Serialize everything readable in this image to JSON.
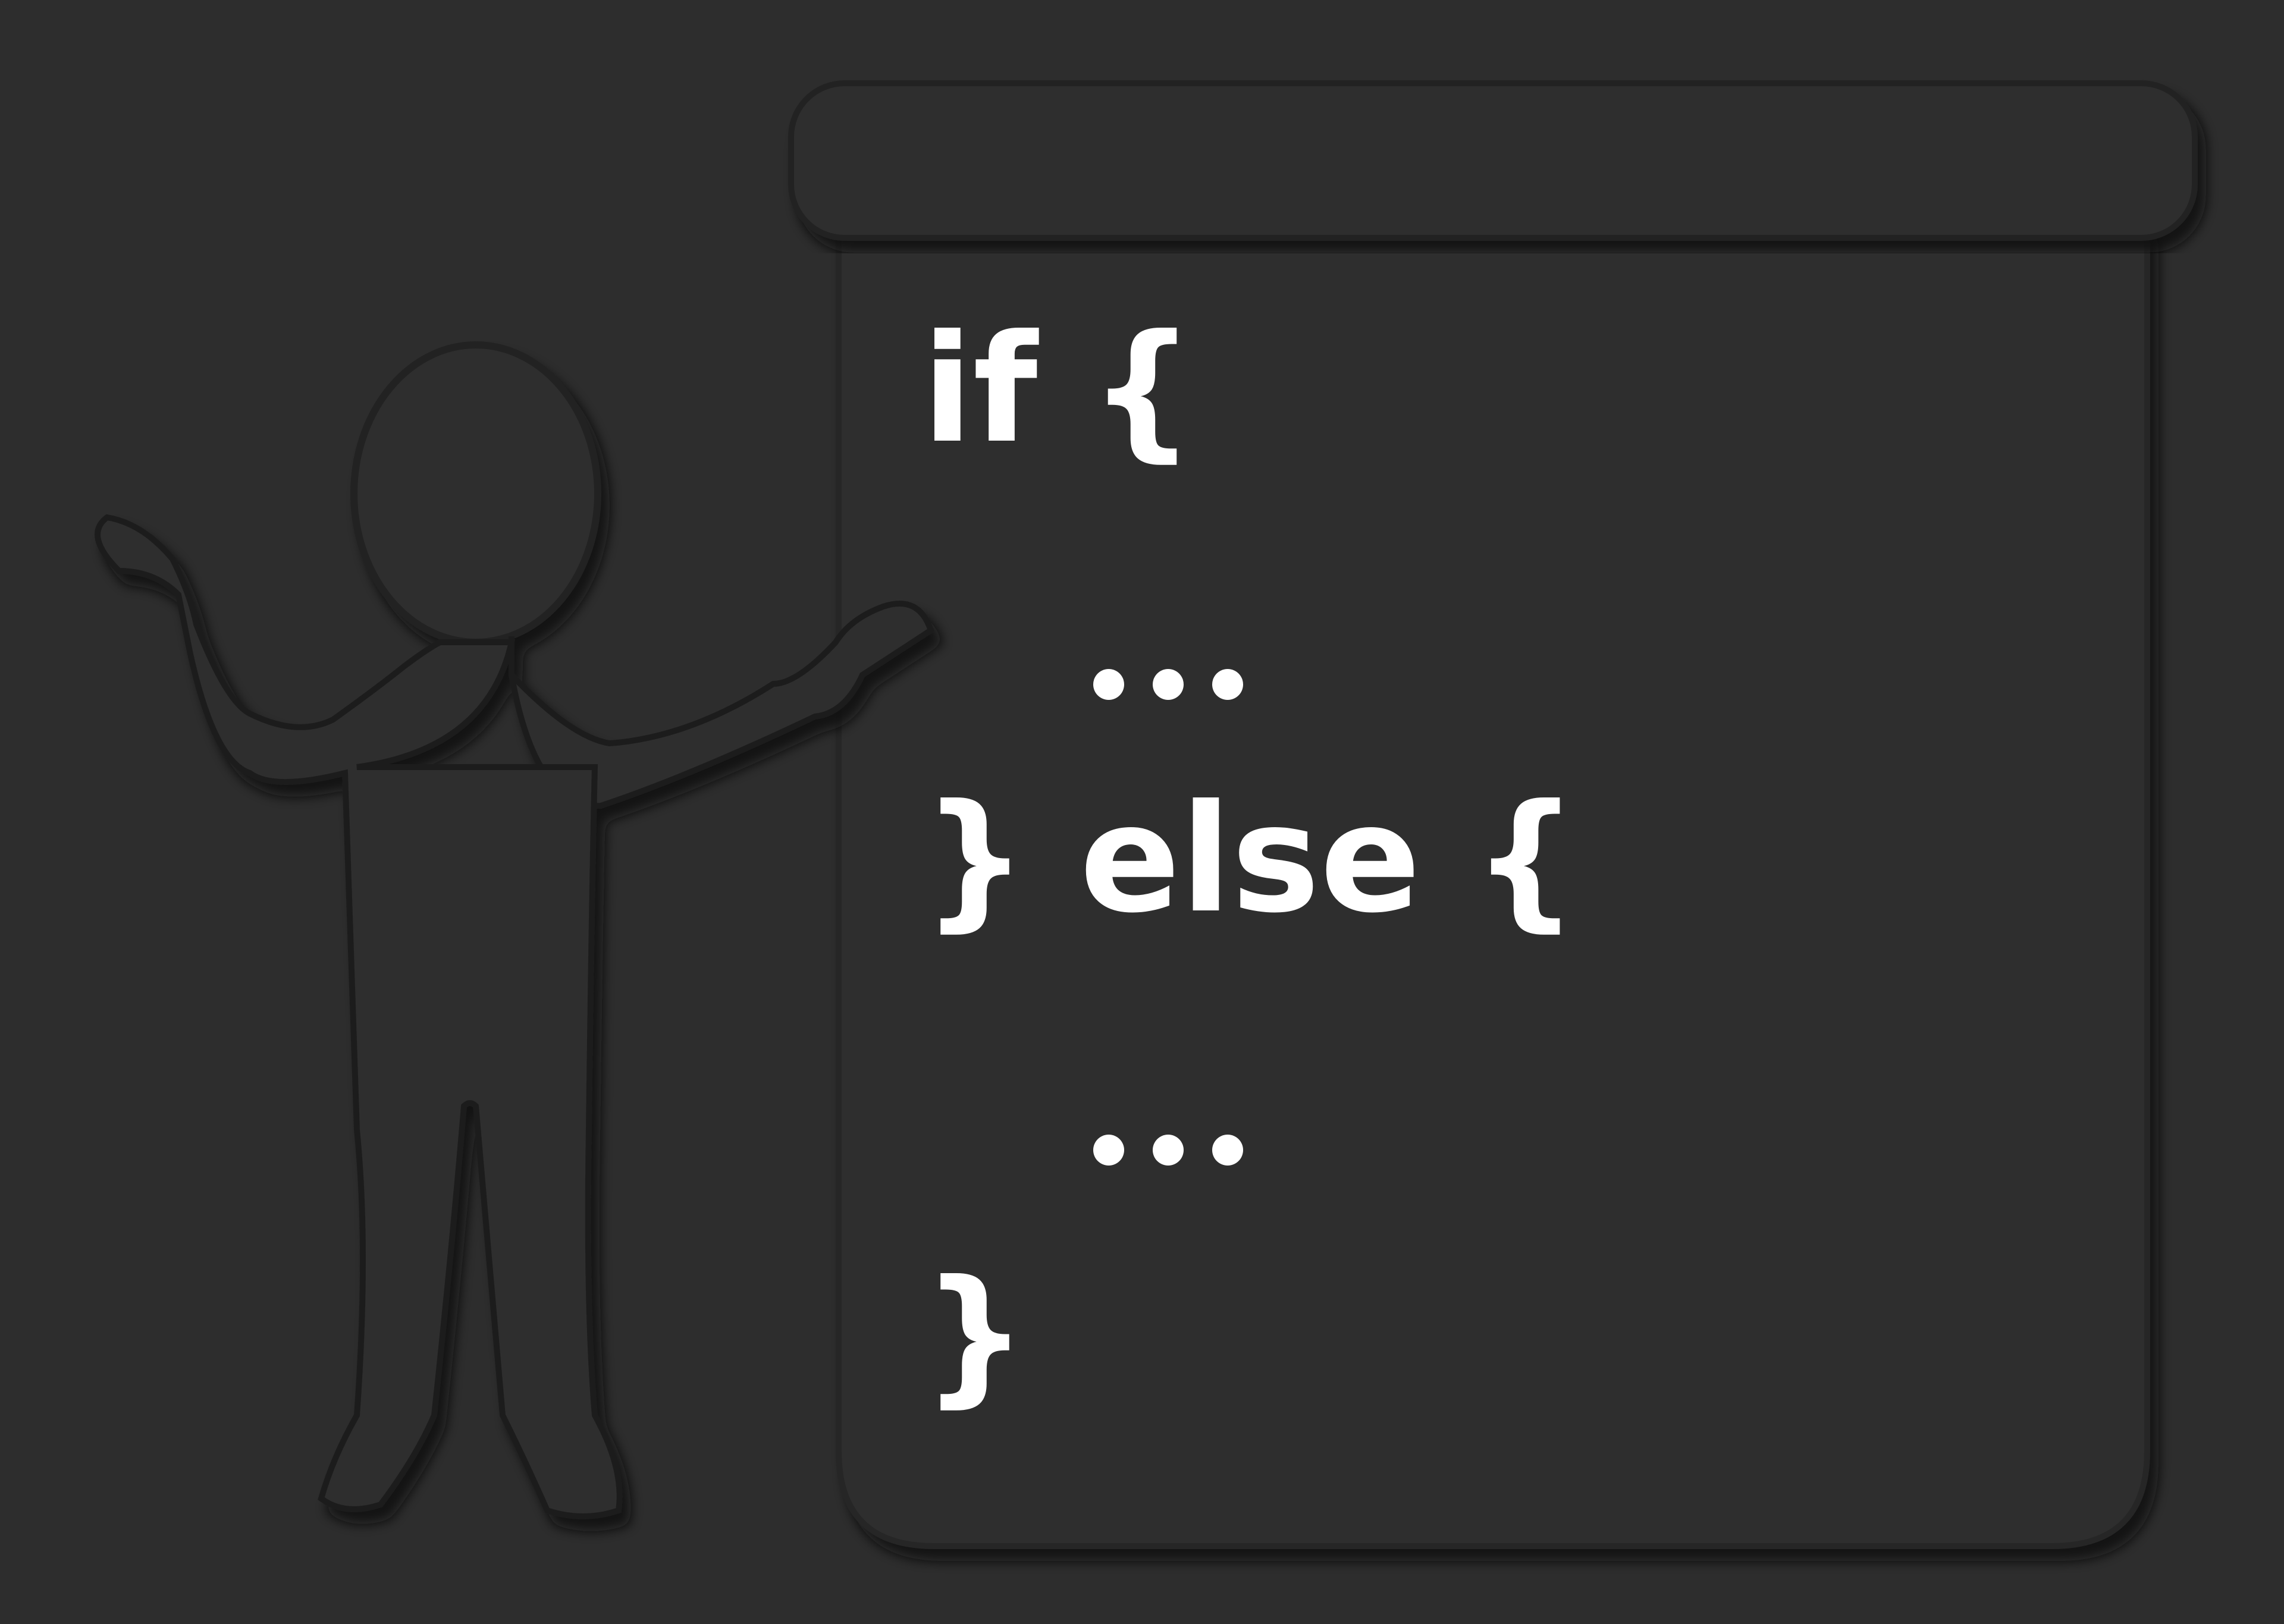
{
  "code": {
    "line1": "if {",
    "line2": "} else {",
    "line3": "}",
    "ellipsis_dot_count": 3
  },
  "colors": {
    "background": "#2d2d2d",
    "board": "#2e2e2e",
    "text": "#ffffff",
    "shadow": "#1a1a1a"
  },
  "icons": {
    "figure": "person-figure-icon",
    "board": "presentation-board-icon"
  }
}
